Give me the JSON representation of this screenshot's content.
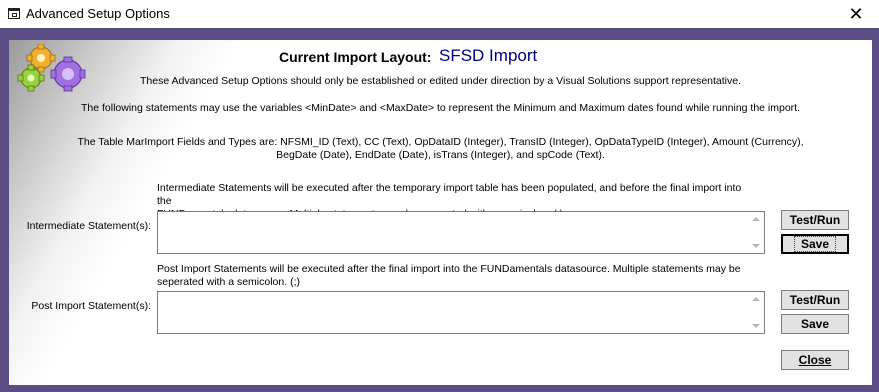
{
  "window": {
    "title": "Advanced Setup Options",
    "close_glyph": "✕"
  },
  "header": {
    "layout_label": "Current Import Layout:",
    "layout_value": "SFSD Import"
  },
  "notes": {
    "warning": "These Advanced Setup Options should only be established or edited under direction by a Visual Solutions support representative.",
    "variables": "The following statements may use the variables <MinDate> and <MaxDate> to represent the Minimum and Maximum dates found while running the import.",
    "fields_line1": "The Table MarImport Fields and Types are: NFSMI_ID (Text), CC (Text), OpDataID (Integer), TransID (Integer), OpDataTypeID (Integer), Amount (Currency),",
    "fields_line2": "BegDate (Date), EndDate (Date), isTrans (Integer), and spCode (Text)."
  },
  "intermediate": {
    "desc_line1": "Intermediate Statements will be executed after the temporary import table has been populated, and before the final import into the",
    "desc_line2": "FUNDamentals  datasource. Multiple statements may be seperated with a semicolon. (;)",
    "label": "Intermediate Statement(s):",
    "value": "",
    "test_button": "Test/Run",
    "save_button": "Save"
  },
  "post_import": {
    "desc_line1": "Post Import Statements will be executed after the final import into the FUNDamentals  datasource. Multiple statements may be",
    "desc_line2": "seperated with a semicolon. (;)",
    "label": "Post Import Statement(s):",
    "value": "",
    "test_button": "Test/Run",
    "save_button": "Save"
  },
  "footer": {
    "close_button": "Close"
  },
  "colors": {
    "frame": "#5b4d83",
    "layout_value": "#000080"
  }
}
